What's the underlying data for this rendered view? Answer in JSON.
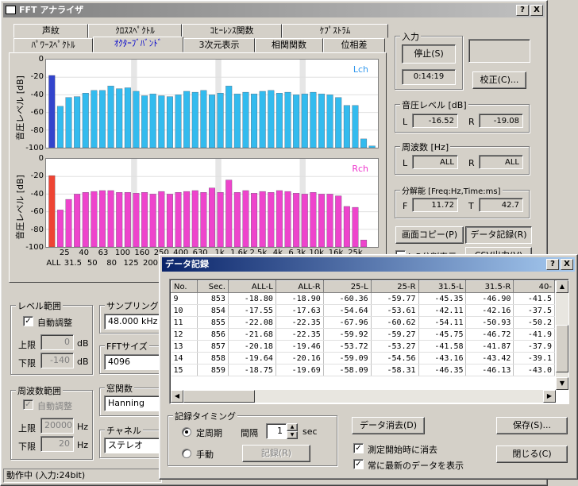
{
  "main": {
    "title": "FFT アナライザ",
    "help_label": "?",
    "close_label": "X",
    "tabs_row1": [
      "声紋",
      "ｸﾛｽｽﾍﾟｸﾄﾙ",
      "ｺﾋｰﾚﾝｽ関数",
      "ｹﾌﾟｽﾄﾗﾑ"
    ],
    "tabs_row2": [
      "ﾊﾟﾜｰｽﾍﾟｸﾄﾙ",
      "ｵｸﾀｰﾌﾞﾊﾞﾝﾄﾞ",
      "3次元表示",
      "相関関数",
      "位相差"
    ],
    "status": "動作中 (入力:24bit)"
  },
  "input_group": {
    "label": "入力",
    "stop_button": "停止(S)",
    "time": "0:14:19",
    "calib_button": "校正(C)..."
  },
  "level_group": {
    "label": "音圧レベル [dB]",
    "l_label": "L",
    "r_label": "R",
    "l_value": "-16.52",
    "r_value": "-19.08"
  },
  "freq_group": {
    "label": "周波数 [Hz]",
    "l_label": "L",
    "r_label": "R",
    "l_value": "ALL",
    "r_value": "ALL"
  },
  "res_group": {
    "label": "分解能 [Freq:Hz,Time:ms]",
    "f_label": "F",
    "t_label": "T",
    "f_value": "11.72",
    "t_value": "42.7"
  },
  "right_buttons": {
    "copy": "画面コピー(P)",
    "record": "データ記録(R)",
    "split": "L,R分割表示",
    "csv": "CSV出力(V)"
  },
  "level_range": {
    "label": "レベル範囲",
    "auto": "自動調整",
    "upper_label": "上限",
    "upper_value": "0",
    "lower_label": "下限",
    "lower_value": "-140",
    "unit": "dB"
  },
  "freq_range": {
    "label": "周波数範囲",
    "auto": "自動調整",
    "upper_label": "上限",
    "upper_value": "20000",
    "lower_label": "下限",
    "lower_value": "20",
    "unit": "Hz"
  },
  "sampling": {
    "label": "サンプリング",
    "value": "48.000 kHz"
  },
  "fft_size": {
    "label": "FFTサイズ",
    "value": "4096"
  },
  "window_fn": {
    "label": "窓関数",
    "value": "Hanning"
  },
  "channel": {
    "label": "チャネル",
    "value": "ステレオ"
  },
  "chart_data": [
    {
      "type": "bar",
      "name": "Lch",
      "ylabel": "音圧レベル [dB]",
      "ylim": [
        -100,
        0
      ],
      "yticks": [
        "0",
        "-20",
        "-40",
        "-60",
        "-80",
        "-100"
      ],
      "color": "#33bbee",
      "first_color": "#3344cc",
      "values": [
        -18,
        -53,
        -43,
        -42,
        -38,
        -35,
        -35,
        -30,
        -33,
        -32,
        -36,
        -41,
        -39,
        -41,
        -42,
        -40,
        -36,
        -37,
        -35,
        -40,
        -38,
        -30,
        -39,
        -37,
        -39,
        -36,
        -35,
        -38,
        -37,
        -40,
        -39,
        -37,
        -39,
        -40,
        -43,
        -52,
        -52,
        -90,
        -98
      ]
    },
    {
      "type": "bar",
      "name": "Rch",
      "ylabel": "音圧レベル [dB]",
      "ylim": [
        -100,
        0
      ],
      "yticks": [
        "0",
        "-20",
        "-40",
        "-60",
        "-80",
        "-100"
      ],
      "color": "#ee44cc",
      "first_color": "#ee4433",
      "values": [
        -19,
        -58,
        -46,
        -40,
        -38,
        -37,
        -36,
        -36,
        -38,
        -38,
        -39,
        -38,
        -40,
        -37,
        -40,
        -38,
        -37,
        -36,
        -38,
        -33,
        -38,
        -24,
        -38,
        -36,
        -39,
        -37,
        -38,
        -36,
        -37,
        -39,
        -40,
        -38,
        -40,
        -40,
        -42,
        -54,
        -55,
        -92,
        -100
      ]
    }
  ],
  "xaxis": {
    "top": [
      "25",
      "40",
      "63",
      "100",
      "160",
      "250",
      "400",
      "630",
      "1k",
      "1.6k",
      "2.5k",
      "4k",
      "6.3k",
      "10k",
      "16k",
      "25k"
    ],
    "bottom": [
      "ALL",
      "31.5",
      "50",
      "80",
      "125",
      "200"
    ]
  },
  "dialog": {
    "title": "データ記録",
    "help_label": "?",
    "close_label": "X",
    "columns": [
      "No.",
      "Sec.",
      "ALL-L",
      "ALL-R",
      "25-L",
      "25-R",
      "31.5-L",
      "31.5-R",
      "40-"
    ],
    "rows": [
      [
        "9",
        "853",
        "-18.80",
        "-18.90",
        "-60.36",
        "-59.77",
        "-45.35",
        "-46.90",
        "-41.5"
      ],
      [
        "10",
        "854",
        "-17.55",
        "-17.63",
        "-54.64",
        "-53.61",
        "-42.11",
        "-42.16",
        "-37.5"
      ],
      [
        "11",
        "855",
        "-22.08",
        "-22.35",
        "-67.96",
        "-60.62",
        "-54.11",
        "-50.93",
        "-50.2"
      ],
      [
        "12",
        "856",
        "-21.68",
        "-22.35",
        "-59.92",
        "-59.27",
        "-45.75",
        "-46.72",
        "-41.9"
      ],
      [
        "13",
        "857",
        "-20.18",
        "-19.46",
        "-53.72",
        "-53.27",
        "-41.58",
        "-41.87",
        "-37.9"
      ],
      [
        "14",
        "858",
        "-19.64",
        "-20.16",
        "-59.09",
        "-54.56",
        "-43.16",
        "-43.42",
        "-39.1"
      ],
      [
        "15",
        "859",
        "-18.75",
        "-19.69",
        "-58.09",
        "-58.31",
        "-46.35",
        "-46.13",
        "-43.0"
      ]
    ],
    "timing_group": "記録タイミング",
    "periodic": "定周期",
    "interval_label": "間隔",
    "interval_value": "1",
    "sec_label": "sec",
    "manual": "手動",
    "record_button": "記録(R)",
    "clear_button": "データ消去(D)",
    "save_button": "保存(S)...",
    "clear_on_start": "測定開始時に消去",
    "show_latest": "常に最新のデータを表示",
    "close_button": "閉じる(C)"
  }
}
